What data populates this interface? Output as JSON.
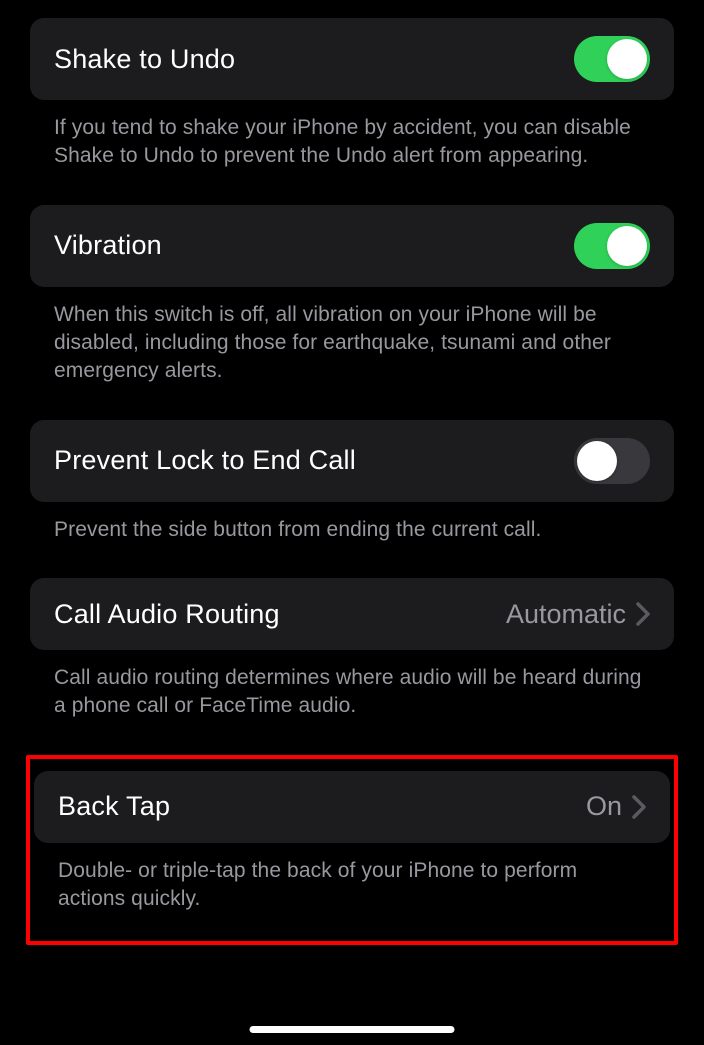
{
  "sections": [
    {
      "title": "Shake to Undo",
      "type": "toggle",
      "on": true,
      "footer": "If you tend to shake your iPhone by accident, you can disable Shake to Undo to prevent the Undo alert from appearing."
    },
    {
      "title": "Vibration",
      "type": "toggle",
      "on": true,
      "footer": "When this switch is off, all vibration on your iPhone will be disabled, including those for earthquake, tsunami and other emergency alerts."
    },
    {
      "title": "Prevent Lock to End Call",
      "type": "toggle",
      "on": false,
      "footer": "Prevent the side button from ending the current call."
    },
    {
      "title": "Call Audio Routing",
      "type": "link",
      "value": "Automatic",
      "footer": "Call audio routing determines where audio will be heard during a phone call or FaceTime audio."
    },
    {
      "title": "Back Tap",
      "type": "link",
      "value": "On",
      "footer": "Double- or triple-tap the back of your iPhone to perform actions quickly.",
      "highlighted": true
    }
  ]
}
